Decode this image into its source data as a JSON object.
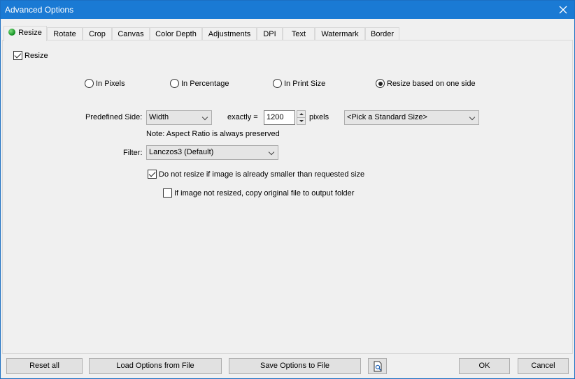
{
  "window": {
    "title": "Advanced Options"
  },
  "tabs": [
    {
      "label": "Resize",
      "active": true
    },
    {
      "label": "Rotate"
    },
    {
      "label": "Crop"
    },
    {
      "label": "Canvas"
    },
    {
      "label": "Color Depth"
    },
    {
      "label": "Adjustments"
    },
    {
      "label": "DPI"
    },
    {
      "label": "Text"
    },
    {
      "label": "Watermark"
    },
    {
      "label": "Border"
    }
  ],
  "resize": {
    "enable_label": "Resize",
    "enable_checked": true,
    "modes": [
      {
        "label": "In Pixels",
        "selected": false
      },
      {
        "label": "In Percentage",
        "selected": false
      },
      {
        "label": "In Print Size",
        "selected": false
      },
      {
        "label": "Resize based on one side",
        "selected": true
      }
    ],
    "predefined_side_label": "Predefined Side:",
    "predefined_side_value": "Width",
    "exactly_label": "exactly =",
    "exactly_value": "1200",
    "units_label": "pixels",
    "standard_size_value": "<Pick a Standard Size>",
    "note": "Note: Aspect Ratio is always preserved",
    "filter_label": "Filter:",
    "filter_value": "Lanczos3 (Default)",
    "no_upscale_label": "Do not resize if image is already smaller than requested size",
    "no_upscale_checked": true,
    "copy_original_label": "If image not resized, copy original file to output folder",
    "copy_original_checked": false
  },
  "footer": {
    "reset_label": "Reset all",
    "load_label": "Load Options from File",
    "save_label": "Save Options to File",
    "ok_label": "OK",
    "cancel_label": "Cancel"
  },
  "colors": {
    "titlebar": "#1a7ad4",
    "active_dot": "#0c8a1c"
  }
}
